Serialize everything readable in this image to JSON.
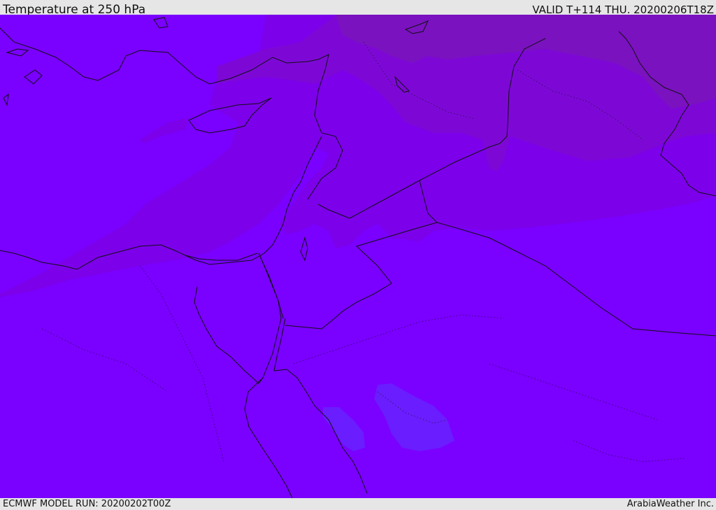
{
  "header": {
    "title": "Temperature at 250 hPa",
    "valid": "VALID T+114 THU. 20200206T18Z"
  },
  "footer": {
    "model_run": "ECMWF MODEL RUN: 20200202T00Z",
    "credit": "ArabiaWeather Inc."
  },
  "colors": {
    "base_field": "#7a00ff",
    "cool_band": "#7c00ea",
    "colder_band": "#7d08d6",
    "coldest_band": "#7a12bf",
    "warm_patch": "#6a1dff",
    "coastline": "#111111",
    "border": "#111111"
  }
}
